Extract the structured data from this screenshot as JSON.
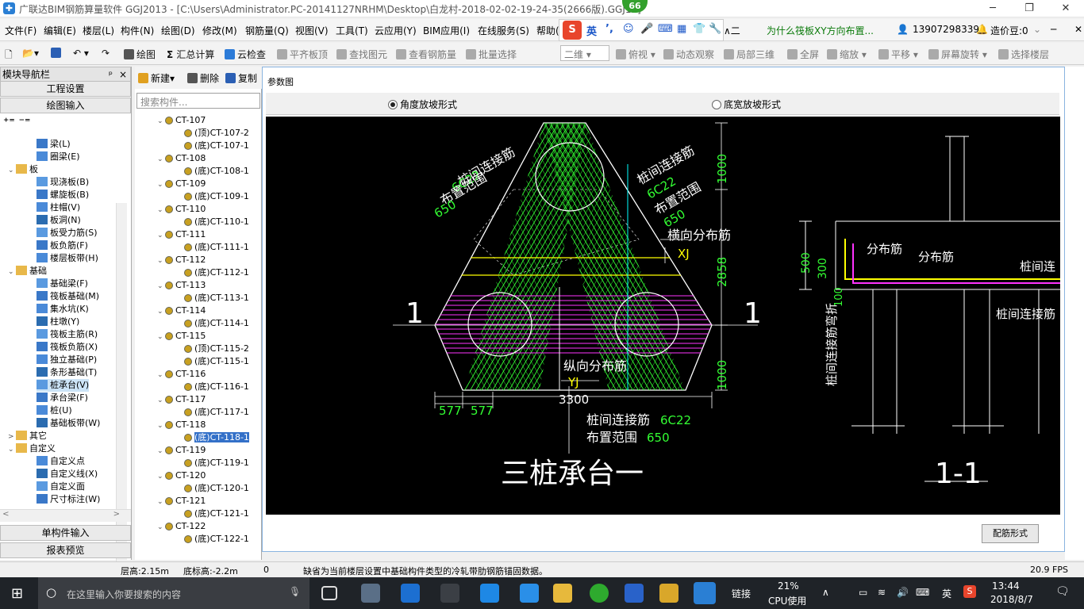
{
  "titlebar": {
    "title": "广联达BIM钢筋算量软件 GGJ2013 - [C:\\Users\\Administrator.PC-20141127NRHM\\Desktop\\白龙村-2018-02-02-19-24-35(2666版).GGJ12]",
    "badge": "66",
    "min": "─",
    "restore": "❐",
    "close": "✕"
  },
  "menu": {
    "items": [
      "文件(F)",
      "编辑(E)",
      "楼层(L)",
      "构件(N)",
      "绘图(D)",
      "修改(M)",
      "钢筋量(Q)",
      "视图(V)",
      "工具(T)",
      "云应用(Y)",
      "BIM应用(I)",
      "在线服务(S)",
      "帮助(H)"
    ],
    "extra": "∧二",
    "question": "为什么筏板XY方向布置...",
    "phone": "13907298339",
    "price": "造价豆:0"
  },
  "ime": {
    "s": "S",
    "mode": "英",
    "punct": "’,"
  },
  "toolbar": {
    "draw": "绘图",
    "sum": "汇总计算",
    "cloud": "云检查",
    "flat": "平齐板顶",
    "find": "查找图元",
    "view": "查看钢筋量",
    "batch": "批量选择",
    "dim": "二维",
    "top": "俯视",
    "dyn": "动态观察",
    "local": "局部三维",
    "full": "全屏",
    "zoom": "缩放",
    "pan": "平移",
    "rotate": "屏幕旋转",
    "floor": "选择楼层"
  },
  "nav": {
    "title": "模块导航栏",
    "pin": "ᵖ",
    "close": "×",
    "project": "工程设置",
    "drawing": "绘图输入",
    "single": "单构件输入",
    "report": "报表预览",
    "tree": [
      {
        "label": "梁(L)",
        "lvl": 2
      },
      {
        "label": "圈梁(E)",
        "lvl": 2
      },
      {
        "label": "板",
        "lvl": 1,
        "exp": "⌄"
      },
      {
        "label": "现浇板(B)",
        "lvl": 2
      },
      {
        "label": "螺旋板(B)",
        "lvl": 2
      },
      {
        "label": "柱帽(V)",
        "lvl": 2
      },
      {
        "label": "板洞(N)",
        "lvl": 2
      },
      {
        "label": "板受力筋(S)",
        "lvl": 2
      },
      {
        "label": "板负筋(F)",
        "lvl": 2
      },
      {
        "label": "楼层板带(H)",
        "lvl": 2
      },
      {
        "label": "基础",
        "lvl": 1,
        "exp": "⌄"
      },
      {
        "label": "基础梁(F)",
        "lvl": 2
      },
      {
        "label": "筏板基础(M)",
        "lvl": 2
      },
      {
        "label": "集水坑(K)",
        "lvl": 2
      },
      {
        "label": "柱墩(Y)",
        "lvl": 2
      },
      {
        "label": "筏板主筋(R)",
        "lvl": 2
      },
      {
        "label": "筏板负筋(X)",
        "lvl": 2
      },
      {
        "label": "独立基础(P)",
        "lvl": 2
      },
      {
        "label": "条形基础(T)",
        "lvl": 2
      },
      {
        "label": "桩承台(V)",
        "lvl": 2,
        "sel": true
      },
      {
        "label": "承台梁(F)",
        "lvl": 2
      },
      {
        "label": "桩(U)",
        "lvl": 2
      },
      {
        "label": "基础板带(W)",
        "lvl": 2
      },
      {
        "label": "其它",
        "lvl": 1,
        "exp": ">"
      },
      {
        "label": "自定义",
        "lvl": 1,
        "exp": "⌄"
      },
      {
        "label": "自定义点",
        "lvl": 2
      },
      {
        "label": "自定义线(X)",
        "lvl": 2
      },
      {
        "label": "自定义面",
        "lvl": 2
      },
      {
        "label": "尺寸标注(W)",
        "lvl": 2
      }
    ]
  },
  "mid": {
    "new": "新建",
    "del": "删除",
    "copy": "复制",
    "search_ph": "搜索构件...",
    "tree": [
      {
        "label": "CT-107",
        "lvl": 1
      },
      {
        "label": "(顶)CT-107-2",
        "lvl": 2
      },
      {
        "label": "(底)CT-107-1",
        "lvl": 2
      },
      {
        "label": "CT-108",
        "lvl": 1
      },
      {
        "label": "(底)CT-108-1",
        "lvl": 2
      },
      {
        "label": "CT-109",
        "lvl": 1
      },
      {
        "label": "(底)CT-109-1",
        "lvl": 2
      },
      {
        "label": "CT-110",
        "lvl": 1
      },
      {
        "label": "(底)CT-110-1",
        "lvl": 2
      },
      {
        "label": "CT-111",
        "lvl": 1
      },
      {
        "label": "(底)CT-111-1",
        "lvl": 2
      },
      {
        "label": "CT-112",
        "lvl": 1
      },
      {
        "label": "(底)CT-112-1",
        "lvl": 2
      },
      {
        "label": "CT-113",
        "lvl": 1
      },
      {
        "label": "(底)CT-113-1",
        "lvl": 2
      },
      {
        "label": "CT-114",
        "lvl": 1
      },
      {
        "label": "(底)CT-114-1",
        "lvl": 2
      },
      {
        "label": "CT-115",
        "lvl": 1
      },
      {
        "label": "(顶)CT-115-2",
        "lvl": 2
      },
      {
        "label": "(底)CT-115-1",
        "lvl": 2
      },
      {
        "label": "CT-116",
        "lvl": 1
      },
      {
        "label": "(底)CT-116-1",
        "lvl": 2
      },
      {
        "label": "CT-117",
        "lvl": 1
      },
      {
        "label": "(底)CT-117-1",
        "lvl": 2
      },
      {
        "label": "CT-118",
        "lvl": 1
      },
      {
        "label": "(底)CT-118-1",
        "lvl": 2,
        "sel": true
      },
      {
        "label": "CT-119",
        "lvl": 1
      },
      {
        "label": "(底)CT-119-1",
        "lvl": 2
      },
      {
        "label": "CT-120",
        "lvl": 1
      },
      {
        "label": "(底)CT-120-1",
        "lvl": 2
      },
      {
        "label": "CT-121",
        "lvl": 1
      },
      {
        "label": "(底)CT-121-1",
        "lvl": 2
      },
      {
        "label": "CT-122",
        "lvl": 1
      },
      {
        "label": "(底)CT-122-1",
        "lvl": 2
      }
    ]
  },
  "dialog": {
    "title": "参数图",
    "radio1": "角度放坡形式",
    "radio2": "底宽放坡形式",
    "config": "配筋形式",
    "cad": {
      "lbl_conn_l": "桩间连接筋",
      "lbl_6c22_l": "6C22",
      "lbl_range_l": "布置范围",
      "lbl_650_l": "650",
      "lbl_conn_r": "桩间连接筋",
      "lbl_6c22_r": "6C22",
      "lbl_range_r": "布置范围",
      "lbl_650_r": "650",
      "lbl_trans": "横向分布筋",
      "lbl_xj": "XJ",
      "lbl_long": "纵向分布筋",
      "lbl_yj": "YJ",
      "dim_1000a": "1000",
      "dim_2858": "2858",
      "dim_1000b": "1000",
      "dim_3300": "3300",
      "dim_577a": "577",
      "dim_577b": "577",
      "lbl_conn_b": "桩间连接筋",
      "lbl_6c22_b": "6C22",
      "lbl_range_b": "布置范围",
      "lbl_650_b": "650",
      "sec1": "1",
      "sec2": "1",
      "title": "三桩承台一",
      "s_dist1": "分布筋",
      "s_dist2": "分布筋",
      "s_conn1": "桩间连",
      "s_conn2": "桩间连接筋",
      "s_500": "500",
      "s_300": "300",
      "s_100": "100",
      "s_vert": "桩间连接筋弯折",
      "s_title": "1-1"
    }
  },
  "status": {
    "floor_h": "层高:2.15m",
    "bottom_h": "底标高:-2.2m",
    "zero": "0",
    "msg": "缺省为当前楼层设置中基础构件类型的冷轧带肋钢筋锚固数据。",
    "fps": "20.9 FPS"
  },
  "taskbar": {
    "search": "在这里输入你要搜索的内容",
    "link": "链接",
    "cpu_pct": "21%",
    "cpu": "CPU使用",
    "lang": "英",
    "time": "13:44",
    "date": "2018/8/7"
  },
  "colors": {
    "green": "#33ff33",
    "yellow": "#ffff00",
    "magenta": "#ff33ff",
    "cyan": "#00ffff",
    "white": "#ffffff"
  }
}
